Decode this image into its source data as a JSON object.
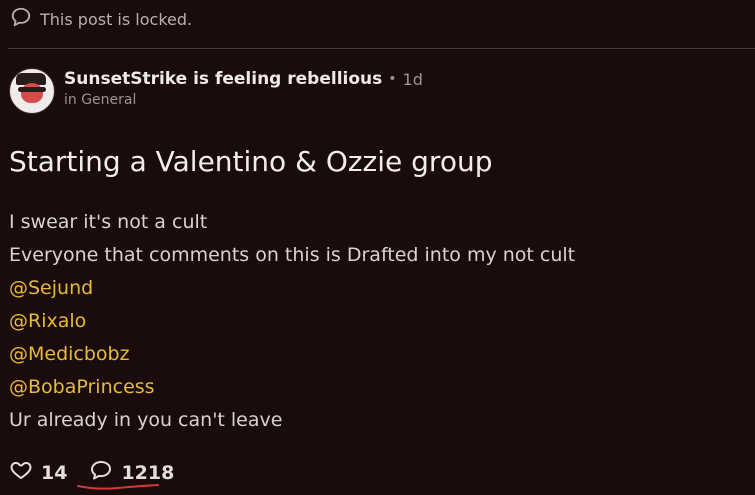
{
  "locked_notice": {
    "icon": "comment-bubble-icon",
    "text": "This post is locked."
  },
  "post": {
    "author": "SunsetStrike is feeling rebellious",
    "separator": "•",
    "time_ago": "1d",
    "community_prefix": "in General",
    "title": "Starting a Valentino & Ozzie group",
    "lines": [
      {
        "text": "I swear it's not a cult",
        "type": "text"
      },
      {
        "text": "Everyone that comments on this is Drafted into my not cult",
        "type": "text"
      },
      {
        "text": "@Sejund",
        "type": "mention"
      },
      {
        "text": "@Rixalo",
        "type": "mention"
      },
      {
        "text": "@Medicbobz",
        "type": "mention"
      },
      {
        "text": "@BobaPrincess",
        "type": "mention"
      },
      {
        "text": "Ur already in you can't leave",
        "type": "text"
      }
    ]
  },
  "actions": {
    "likes": {
      "icon": "heart-icon",
      "count": "14"
    },
    "comments": {
      "icon": "comment-bubble-icon",
      "count": "1218"
    }
  },
  "colors": {
    "background": "#1a0c0c",
    "mention": "#e8b93a",
    "annotation_underline": "#d23a3a"
  }
}
